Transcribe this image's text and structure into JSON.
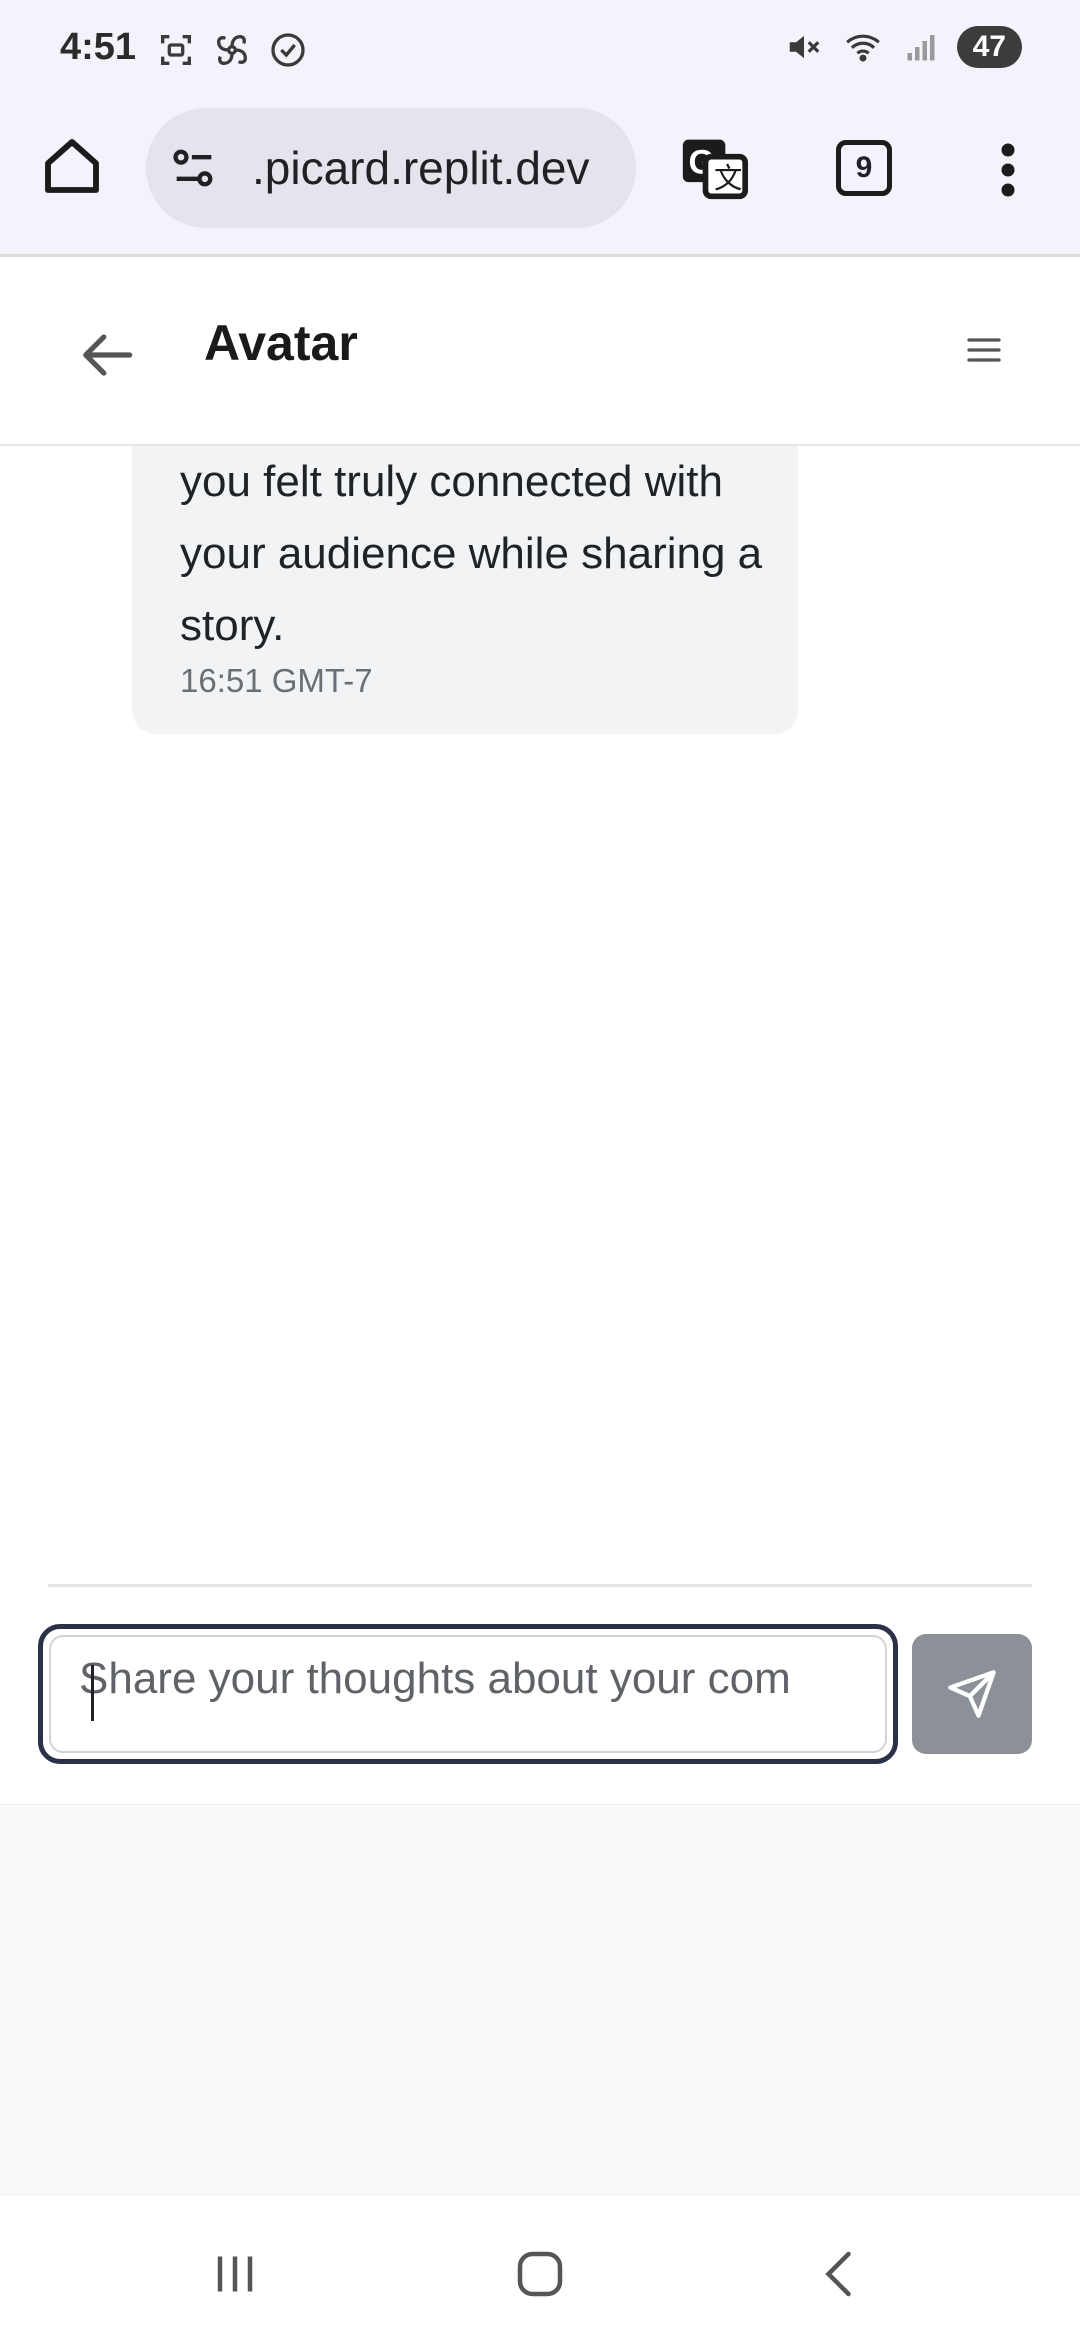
{
  "status_bar": {
    "time": "4:51",
    "battery": "47"
  },
  "browser": {
    "url": ".picard.replit.dev",
    "tab_count": "9"
  },
  "header": {
    "title": "Avatar"
  },
  "chat": {
    "message_text": "you felt truly connected with your audience while sharing a story.",
    "message_time": "16:51 GMT-7"
  },
  "composer": {
    "placeholder": "Share your thoughts about your com"
  },
  "colors": {
    "send_button": "#8c9097",
    "input_border": "#2b3147",
    "bubble": "#f2f3f5"
  }
}
